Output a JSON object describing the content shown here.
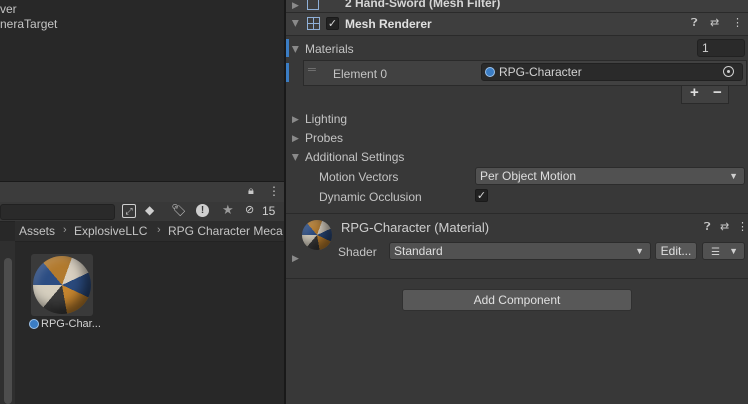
{
  "hierarchy": {
    "rows": [
      "ver",
      "neraTarget"
    ]
  },
  "project": {
    "lock_icon": "lock-icon",
    "menu_icon": "kebab-menu-icon",
    "hidden_count": "15",
    "breadcrumb": [
      "Assets",
      "ExplosiveLLC",
      "RPG Character Meca"
    ],
    "asset": {
      "name": "RPG-Char..."
    }
  },
  "inspector": {
    "prev_component": "2 Hand-Sword (Mesh Filter)",
    "mesh_renderer": {
      "title": "Mesh Renderer",
      "materials_label": "Materials",
      "materials_count": "1",
      "element_label": "Element 0",
      "element_value": "RPG-Character",
      "add_button": "+",
      "remove_button": "−",
      "lighting": "Lighting",
      "probes": "Probes",
      "additional_settings": "Additional Settings",
      "motion_vectors_label": "Motion Vectors",
      "motion_vectors_value": "Per Object Motion",
      "dynamic_occlusion_label": "Dynamic Occlusion",
      "dynamic_occlusion_checked": true
    },
    "material": {
      "title": "RPG-Character (Material)",
      "shader_label": "Shader",
      "shader_value": "Standard",
      "edit_button": "Edit..."
    },
    "add_component": "Add Component"
  },
  "colors": {
    "panel_bg": "#383838",
    "hierarchy_bg": "#282828",
    "accent_blue": "#3b7dc4"
  }
}
